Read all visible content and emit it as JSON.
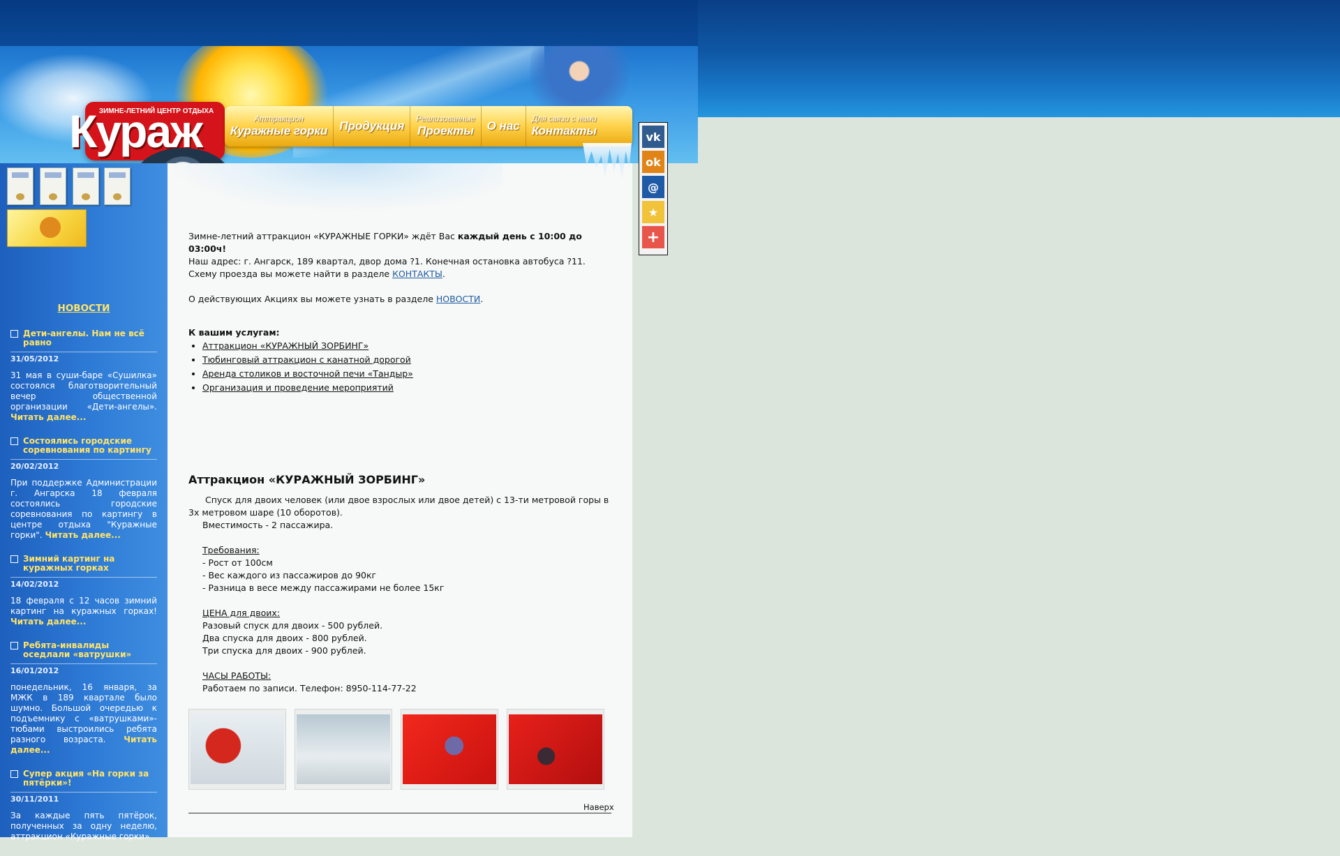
{
  "header": {
    "logo_subtitle": "ЗИМНЕ-ЛЕТНИЙ ЦЕНТР ОТДЫХА",
    "logo_title": "Кураж",
    "menu": [
      {
        "top": "Аттракцион",
        "main": "Куражные горки"
      },
      {
        "top": "",
        "main": "Продукция"
      },
      {
        "top": "Реализованные",
        "main": "Проекты"
      },
      {
        "top": "",
        "main": "О нас"
      },
      {
        "top": "Для связи с нами",
        "main": "Контакты"
      }
    ]
  },
  "social": [
    {
      "icon": "vk-icon",
      "glyph": "vk",
      "color": "#2f5b8e"
    },
    {
      "icon": "odnoklassniki-icon",
      "glyph": "ok",
      "color": "#e08418"
    },
    {
      "icon": "mail-icon",
      "glyph": "@",
      "color": "#1f5aa6"
    },
    {
      "icon": "star-icon",
      "glyph": "★",
      "color": "#f1c33b"
    },
    {
      "icon": "plus-icon",
      "glyph": "+",
      "color": "#e8554a"
    }
  ],
  "sidebar": {
    "news_heading": "НОВОСТИ",
    "news": [
      {
        "title": "Дети-ангелы. Нам не всё равно",
        "date": "31/05/2012",
        "text": "31 мая в суши-баре «Сушилка» состоялся благотворительный вечер общественной организации «Дети-ангелы».",
        "more": "Читать далее..."
      },
      {
        "title": "Состоялись городские соревнования по картингу",
        "date": "20/02/2012",
        "text": "При поддержке Администрации г. Ангарска 18 февраля состоялись городские соревнования по картингу в центре отдыха \"Куражные горки\".",
        "more": "Читать далее..."
      },
      {
        "title": "Зимний картинг на куражных горках",
        "date": "14/02/2012",
        "text": "18 февраля с 12 часов зимний картинг на куражных горках!",
        "more": "Читать далее..."
      },
      {
        "title": "Ребята-инвалиды оседлали «ватрушки»",
        "date": "16/01/2012",
        "text": "понедельник, 16 января, за МЖК в 189 квартале было шумно. Большой очередью к подъемнику с «ватрушками»-тюбами выстроились ребята разного возраста.",
        "more": "Читать далее..."
      },
      {
        "title": "Супер акция «На горки за пятёрки»!",
        "date": "30/11/2011",
        "text": "За каждые пять пятёрок, полученных за одну неделю, аттракцион «Куражные горки»",
        "more": ""
      }
    ]
  },
  "main": {
    "intro1_a": "Зимне-летний аттракцион «КУРАЖНЫЕ ГОРКИ» ждёт Вас ",
    "intro1_b": "каждый день с 10:00 до 03:00ч!",
    "intro2": "Наш адрес: г. Ангарск, 189 квартал, двор дома ?1. Конечная остановка автобуса ?11.",
    "intro3_a": "Схему проезда вы можете найти в разделе ",
    "intro3_link": "КОНТАКТЫ",
    "intro4_a": "О действующих Акциях вы можете узнать в разделе ",
    "intro4_link": "НОВОСТИ",
    "services_title": "К вашим услугам:",
    "services": [
      "Аттракцион «КУРАЖНЫЙ ЗОРБИНГ»",
      "Тюбинговый аттракцион с канатной дорогой",
      "Аренда столиков и восточной печи «Тандыр»",
      "Организация и проведение мероприятий"
    ],
    "attraction_title": "Аттракцион «КУРАЖНЫЙ ЗОРБИНГ»",
    "desc1": "Спуск для двоих человек (или двое взрослых или двое детей) с 13-ти метровой горы в 3х метровом шаре (10 оборотов).",
    "desc2": "Вместимость - 2 пассажира.",
    "req_title": "Требования:",
    "req": [
      "- Рост от 100см",
      "- Вес каждого из пассажиров до 90кг",
      "- Разница в весе между пассажирами не более 15кг"
    ],
    "price_title": "ЦЕНА для двоих:",
    "prices": [
      "Разовый спуск для двоих - 500 рублей.",
      "Два спуска для двоих - 800 рублей.",
      "Три спуска для двоих - 900 рублей."
    ],
    "hours_title": "ЧАСЫ РАБОТЫ:",
    "hours": "Работаем по записи. Телефон: 8950-114-77-22",
    "top_link": "Наверх"
  }
}
